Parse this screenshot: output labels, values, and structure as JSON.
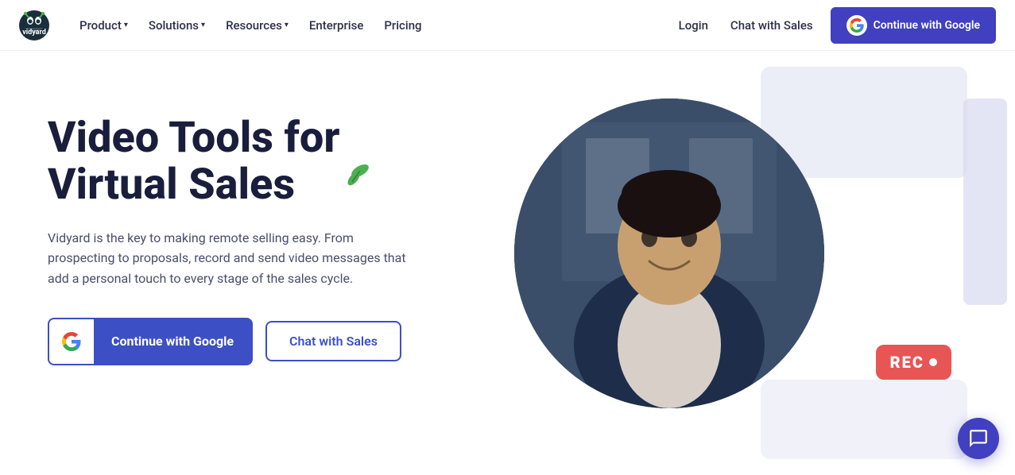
{
  "nav": {
    "logo_alt": "Vidyard",
    "links": [
      {
        "label": "Product",
        "has_dropdown": true
      },
      {
        "label": "Solutions",
        "has_dropdown": true
      },
      {
        "label": "Resources",
        "has_dropdown": true
      },
      {
        "label": "Enterprise",
        "has_dropdown": false
      },
      {
        "label": "Pricing",
        "has_dropdown": false
      }
    ],
    "login_label": "Login",
    "chat_sales_label": "Chat with Sales",
    "google_btn_label": "Continue with Google"
  },
  "hero": {
    "title_line1": "Video Tools for",
    "title_line2": "Virtual Sales",
    "leaf_emoji": "🌿",
    "description": "Vidyard is the key to making remote selling easy. From prospecting to proposals, record and send video messages that add a personal touch to every stage of the sales cycle.",
    "btn_google_label": "Continue with Google",
    "btn_chat_label": "Chat with Sales",
    "rec_label": "REC"
  },
  "chat_widget": {
    "icon": "💬"
  }
}
